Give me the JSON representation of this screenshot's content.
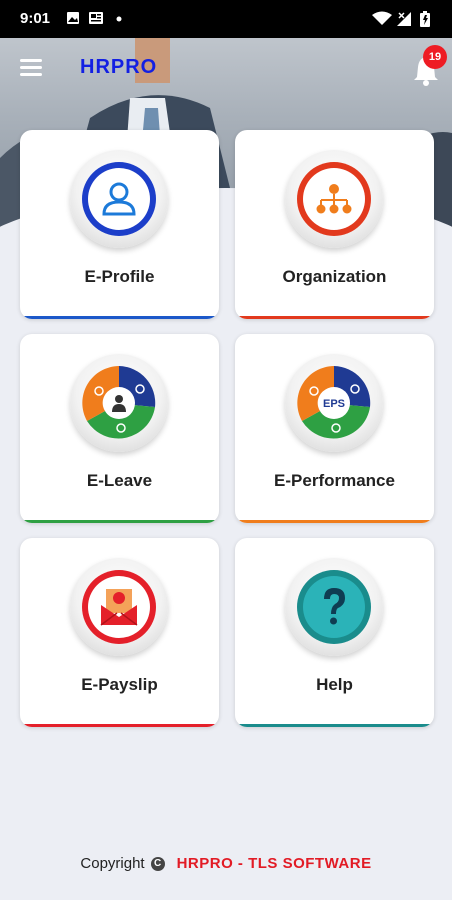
{
  "status_bar": {
    "time": "9:01"
  },
  "header": {
    "brand": "HRPRO",
    "notification_count": "19"
  },
  "tiles": [
    {
      "label": "E-Profile",
      "icon": "user-icon",
      "accent": "#1c58c9"
    },
    {
      "label": "Organization",
      "icon": "org-chart-icon",
      "accent": "#e2391d"
    },
    {
      "label": "E-Leave",
      "icon": "leave-cycle-icon",
      "accent": "#2ea043"
    },
    {
      "label": "E-Performance",
      "icon": "eps-cycle-icon",
      "accent": "#f07d1c",
      "icon_text": "EPS"
    },
    {
      "label": "E-Payslip",
      "icon": "payslip-envelope-icon",
      "accent": "#e4202a"
    },
    {
      "label": "Help",
      "icon": "question-icon",
      "accent": "#1a8c8c"
    }
  ],
  "footer": {
    "copyright": "Copyright",
    "symbol": "C",
    "company": "HRPRO - TLS SOFTWARE"
  },
  "colors": {
    "brand": "#1320e3",
    "badge": "#ee1c24",
    "footer_company": "#e21b25"
  }
}
